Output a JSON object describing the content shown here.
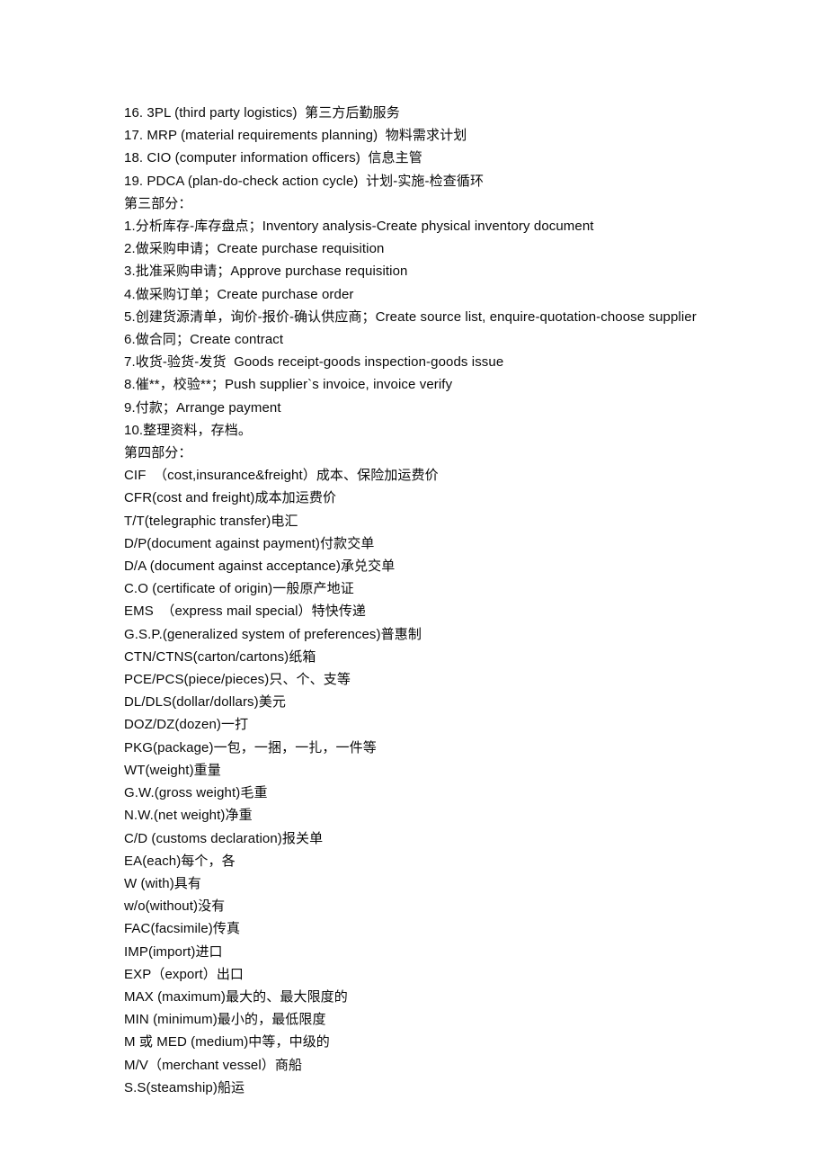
{
  "document": {
    "background_color": "#ffffff",
    "text_color": "#0a0a0a",
    "lines": [
      "16. 3PL (third party logistics)  第三方后勤服务",
      "17. MRP (material requirements planning)  物料需求计划",
      "18. CIO (computer information officers)  信息主管",
      "19. PDCA (plan-do-check action cycle)  计划-实施-检查循环",
      "第三部分：",
      "1.分析库存-库存盘点；Inventory analysis-Create physical inventory document",
      "2.做采购申请；Create purchase requisition",
      "3.批准采购申请；Approve purchase requisition",
      "4.做采购订单；Create purchase order",
      "5.创建货源清单，询价-报价-确认供应商；Create source list, enquire-quotation-choose supplier",
      "6.做合同；Create contract",
      "7.收货-验货-发货  Goods receipt-goods inspection-goods issue",
      "8.催**，校验**；Push supplier`s invoice, invoice verify",
      "9.付款；Arrange payment",
      "10.整理资料，存档。",
      "第四部分：",
      "CIF  （cost,insurance&freight）成本、保险加运费价",
      "CFR(cost and freight)成本加运费价",
      "T/T(telegraphic transfer)电汇",
      "D/P(document against payment)付款交单",
      "D/A (document against acceptance)承兑交单",
      "C.O (certificate of origin)一般原产地证",
      "EMS  （express mail special）特快传递",
      "G.S.P.(generalized system of preferences)普惠制",
      "CTN/CTNS(carton/cartons)纸箱",
      "PCE/PCS(piece/pieces)只、个、支等",
      "DL/DLS(dollar/dollars)美元",
      "DOZ/DZ(dozen)一打",
      "PKG(package)一包，一捆，一扎，一件等",
      "WT(weight)重量",
      "G.W.(gross weight)毛重",
      "N.W.(net weight)净重",
      "C/D (customs declaration)报关单",
      "EA(each)每个，各",
      "W (with)具有",
      "w/o(without)没有",
      "FAC(facsimile)传真",
      "IMP(import)进口",
      "EXP（export）出口",
      "MAX (maximum)最大的、最大限度的",
      "MIN (minimum)最小的，最低限度",
      "M 或 MED (medium)中等，中级的",
      "M/V（merchant vessel）商船",
      "S.S(steamship)船运"
    ]
  }
}
